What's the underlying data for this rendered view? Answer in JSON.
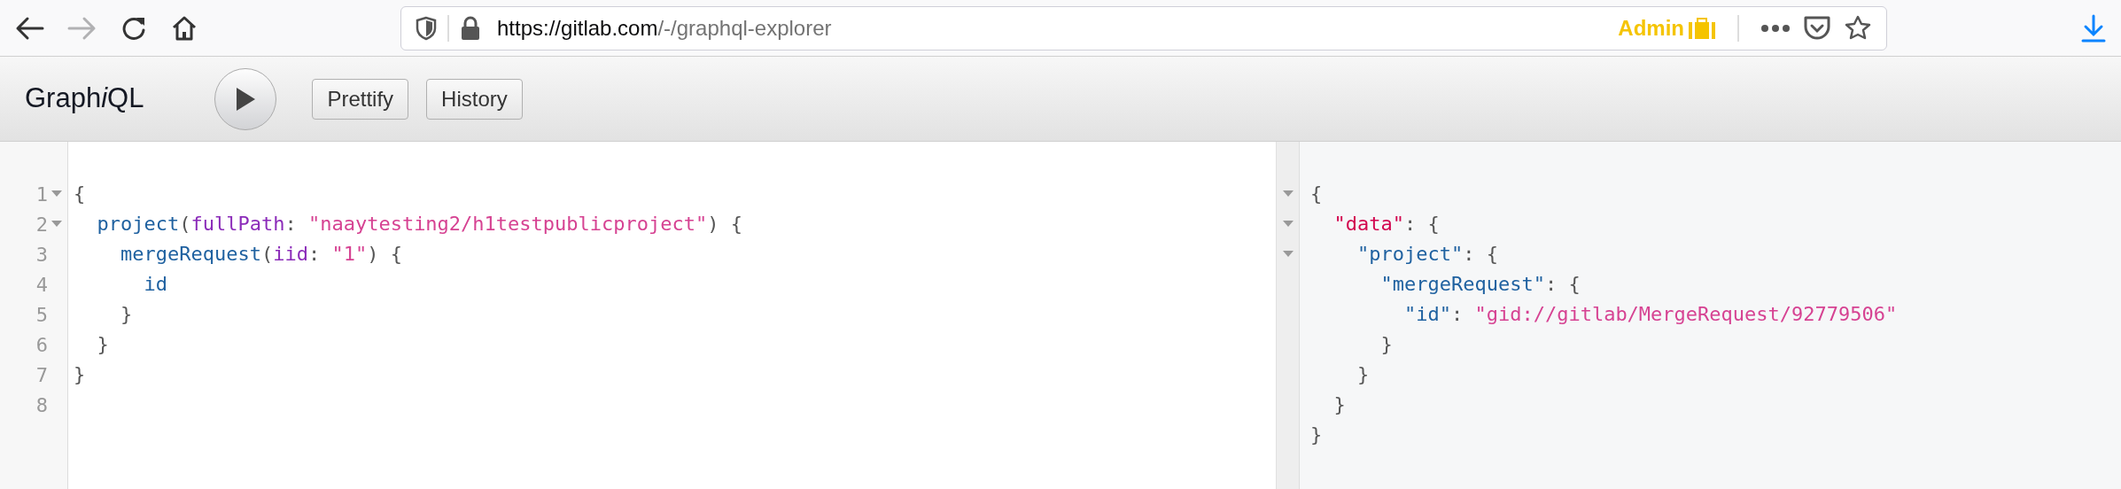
{
  "browser": {
    "back_disabled": false,
    "forward_disabled": true,
    "url_host": "https://gitlab.com",
    "url_path": "/-/graphql-explorer",
    "badge": "Admin"
  },
  "toolbar": {
    "title_start": "Graph",
    "title_italic": "i",
    "title_end": "QL",
    "buttons": [
      "Prettify",
      "History"
    ]
  },
  "query_editor": {
    "lines": [
      {
        "number": "1",
        "fold": true,
        "tokens": [
          {
            "kind": "punct",
            "text": "{"
          }
        ]
      },
      {
        "number": "2",
        "fold": true,
        "tokens": [
          {
            "kind": "field",
            "text": "project"
          },
          {
            "kind": "punct",
            "text": "("
          },
          {
            "kind": "arg",
            "text": "fullPath"
          },
          {
            "kind": "punct",
            "text": ": "
          },
          {
            "kind": "string",
            "text": "\"naaytesting2/h1testpublicproject\""
          },
          {
            "kind": "punct",
            "text": ") {"
          }
        ]
      },
      {
        "number": "3",
        "fold": false,
        "tokens": [
          {
            "kind": "field",
            "text": "mergeRequest"
          },
          {
            "kind": "punct",
            "text": "("
          },
          {
            "kind": "arg",
            "text": "iid"
          },
          {
            "kind": "punct",
            "text": ": "
          },
          {
            "kind": "string",
            "text": "\"1\""
          },
          {
            "kind": "punct",
            "text": ") {"
          }
        ]
      },
      {
        "number": "4",
        "fold": false,
        "tokens": [
          {
            "kind": "field",
            "text": "id"
          }
        ]
      },
      {
        "number": "5",
        "fold": false,
        "tokens": [
          {
            "kind": "punct",
            "text": "}"
          }
        ]
      },
      {
        "number": "6",
        "fold": false,
        "tokens": [
          {
            "kind": "punct",
            "text": "}"
          }
        ]
      },
      {
        "number": "7",
        "fold": false,
        "tokens": [
          {
            "kind": "punct",
            "text": "}"
          }
        ]
      },
      {
        "number": "8",
        "fold": false
      }
    ]
  },
  "result_viewer": {
    "lines": [
      {
        "fold": true,
        "tokens": [
          {
            "kind": "punct",
            "text": "{"
          }
        ]
      },
      {
        "fold": true,
        "tokens": [
          {
            "kind": "def",
            "text": "\"data\""
          },
          {
            "kind": "punct",
            "text": ": {"
          }
        ]
      },
      {
        "fold": true,
        "tokens": [
          {
            "kind": "field",
            "text": "\"project\""
          },
          {
            "kind": "punct",
            "text": ": {"
          }
        ]
      },
      {
        "fold": false,
        "tokens": [
          {
            "kind": "field",
            "text": "\"mergeRequest\""
          },
          {
            "kind": "punct",
            "text": ": {"
          }
        ]
      },
      {
        "fold": false,
        "tokens": [
          {
            "kind": "field",
            "text": "\"id\""
          },
          {
            "kind": "punct",
            "text": ": "
          },
          {
            "kind": "string",
            "text": "\"gid://gitlab/MergeRequest/92779506\""
          }
        ]
      },
      {
        "fold": false,
        "tokens": [
          {
            "kind": "punct",
            "text": "}"
          }
        ]
      },
      {
        "fold": false,
        "tokens": [
          {
            "kind": "punct",
            "text": "}"
          }
        ]
      },
      {
        "fold": false,
        "tokens": [
          {
            "kind": "punct",
            "text": "}"
          }
        ]
      },
      {
        "fold": false,
        "tokens": [
          {
            "kind": "punct",
            "text": "}"
          }
        ]
      }
    ]
  }
}
